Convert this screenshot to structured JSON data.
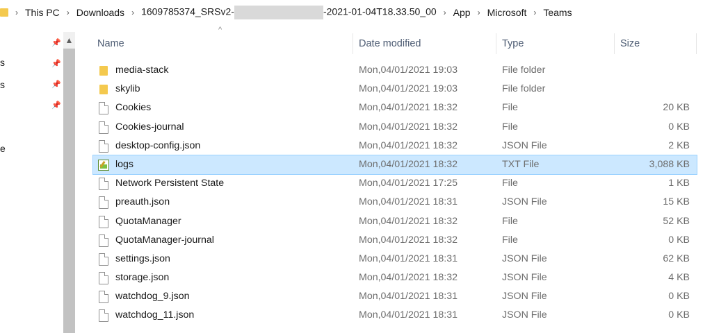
{
  "breadcrumb": {
    "items": [
      "This PC",
      "Downloads",
      "1609785374_SRSv2-",
      "-2021-01-04T18.33.50_00",
      "App",
      "Microsoft",
      "Teams"
    ],
    "separator": "›"
  },
  "navpane": {
    "letters": [
      "s",
      "s",
      "e"
    ]
  },
  "columns": {
    "name": "Name",
    "date": "Date modified",
    "type": "Type",
    "size": "Size"
  },
  "files": [
    {
      "name": "media-stack",
      "date": "Mon,04/01/2021 19:03",
      "type": "File folder",
      "size": "",
      "icon": "folder-icon"
    },
    {
      "name": "skylib",
      "date": "Mon,04/01/2021 19:03",
      "type": "File folder",
      "size": "",
      "icon": "folder-icon"
    },
    {
      "name": "Cookies",
      "date": "Mon,04/01/2021 18:32",
      "type": "File",
      "size": "20 KB",
      "icon": "file-icon"
    },
    {
      "name": "Cookies-journal",
      "date": "Mon,04/01/2021 18:32",
      "type": "File",
      "size": "0 KB",
      "icon": "file-icon"
    },
    {
      "name": "desktop-config.json",
      "date": "Mon,04/01/2021 18:32",
      "type": "JSON File",
      "size": "2 KB",
      "icon": "file-icon"
    },
    {
      "name": "logs",
      "date": "Mon,04/01/2021 18:32",
      "type": "TXT File",
      "size": "3,088 KB",
      "icon": "text-file-icon",
      "selected": true
    },
    {
      "name": "Network Persistent State",
      "date": "Mon,04/01/2021 17:25",
      "type": "File",
      "size": "1 KB",
      "icon": "file-icon"
    },
    {
      "name": "preauth.json",
      "date": "Mon,04/01/2021 18:31",
      "type": "JSON File",
      "size": "15 KB",
      "icon": "file-icon"
    },
    {
      "name": "QuotaManager",
      "date": "Mon,04/01/2021 18:32",
      "type": "File",
      "size": "52 KB",
      "icon": "file-icon"
    },
    {
      "name": "QuotaManager-journal",
      "date": "Mon,04/01/2021 18:32",
      "type": "File",
      "size": "0 KB",
      "icon": "file-icon"
    },
    {
      "name": "settings.json",
      "date": "Mon,04/01/2021 18:31",
      "type": "JSON File",
      "size": "62 KB",
      "icon": "file-icon"
    },
    {
      "name": "storage.json",
      "date": "Mon,04/01/2021 18:32",
      "type": "JSON File",
      "size": "4 KB",
      "icon": "file-icon"
    },
    {
      "name": "watchdog_9.json",
      "date": "Mon,04/01/2021 18:31",
      "type": "JSON File",
      "size": "0 KB",
      "icon": "file-icon"
    },
    {
      "name": "watchdog_11.json",
      "date": "Mon,04/01/2021 18:31",
      "type": "JSON File",
      "size": "0 KB",
      "icon": "file-icon"
    }
  ],
  "colors": {
    "selection_bg": "#cce8ff",
    "selection_border": "#99d1ff",
    "folder": "#f4c94e",
    "header_text": "#4c5b72"
  }
}
